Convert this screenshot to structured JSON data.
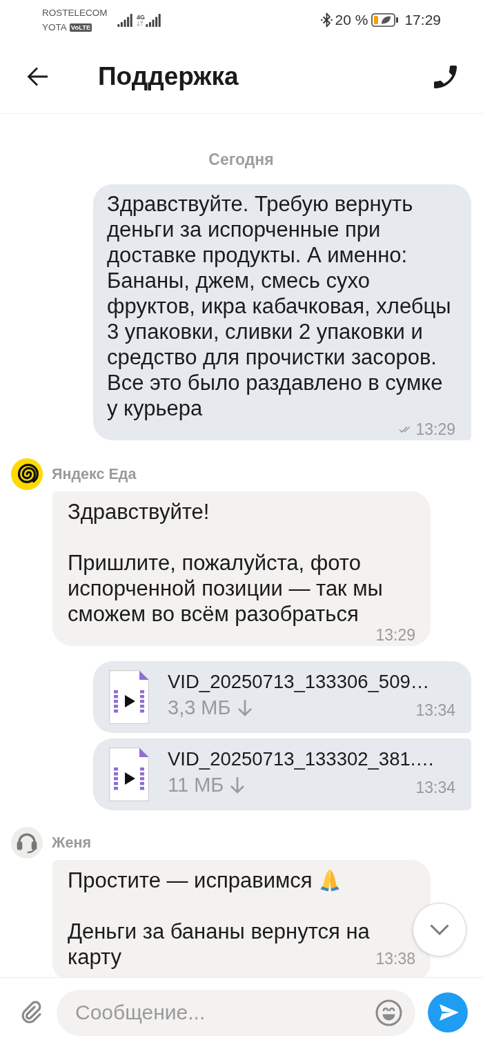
{
  "status_bar": {
    "carriers": [
      {
        "name": "ROSTELECOM"
      },
      {
        "name": "YOTA",
        "badge": "VoLTE"
      }
    ],
    "network": "4G",
    "battery": "20 %",
    "time": "17:29"
  },
  "header": {
    "title": "Поддержка"
  },
  "messages": [
    {
      "kind": "date",
      "text": "Сегодня"
    },
    {
      "kind": "text",
      "outgoing": true,
      "paragraphs": [
        {
          "text": "Здравствуйте. Требую вернуть деньги за испорченные при доставке продукты. А именно: Бананы, джем, смесь сухо фруктов, икра кабачковая, хлебцы 3 упаковки, сливки 2 упаковки и средство для прочистки засоров. Все это было раздавлено в сумке у курьера"
        }
      ],
      "time": "13:29",
      "read": true
    },
    {
      "kind": "text",
      "outgoing": false,
      "sender": "Яндекс Еда",
      "avatar": {
        "kind": "logo"
      },
      "paragraphs": [
        {
          "text": "Здравствуйте!"
        },
        {
          "text": "Пришлите, пожалуйста, фото испорченной позиции — так мы сможем во всём разобраться"
        }
      ],
      "time": "13:29"
    },
    {
      "kind": "file",
      "outgoing": true,
      "name": "VID_20250713_133306_509…",
      "size": "3,3 МБ",
      "downloaded": false,
      "time": "13:34"
    },
    {
      "kind": "file",
      "outgoing": true,
      "name": "VID_20250713_133302_381.…",
      "size": "11 МБ",
      "downloaded": false,
      "time": "13:34"
    },
    {
      "kind": "text",
      "outgoing": false,
      "sender": "Женя",
      "avatar": {
        "kind": "operator"
      },
      "paragraphs": [
        {
          "text": "Простите — исправимся",
          "emoji": true
        },
        {
          "text": "Деньги за бананы вернутся на карту"
        }
      ],
      "time": "13:38"
    }
  ],
  "composer": {
    "placeholder": "Сообщение..."
  }
}
